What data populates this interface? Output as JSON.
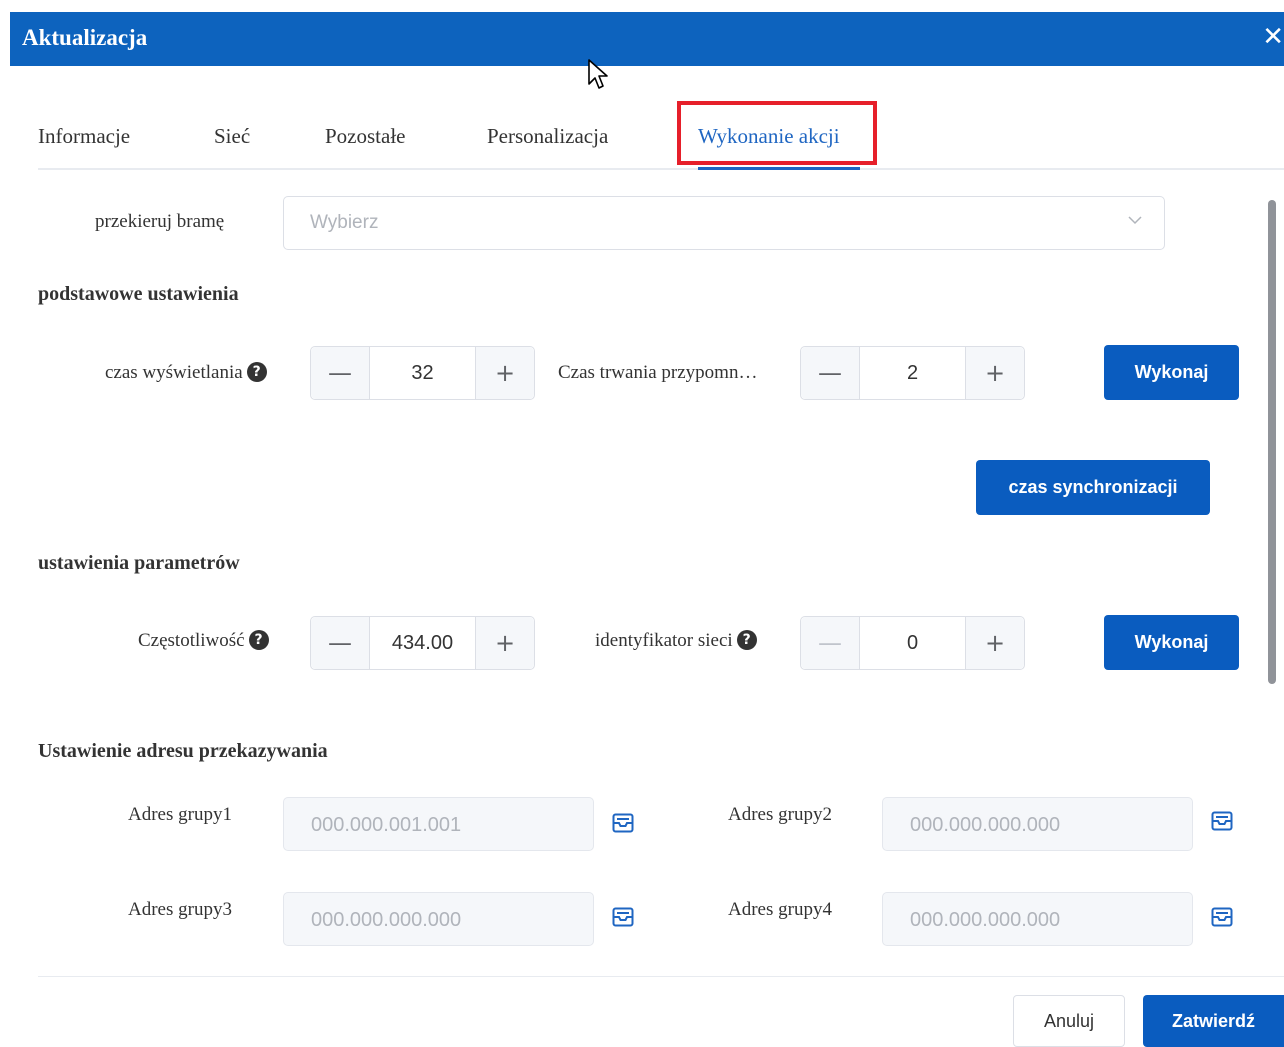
{
  "dialog": {
    "title": "Aktualizacja",
    "close_symbol": "✕"
  },
  "tabs": [
    {
      "label": "Informacje",
      "active": false
    },
    {
      "label": "Sieć",
      "active": false
    },
    {
      "label": "Pozostałe",
      "active": false
    },
    {
      "label": "Personalizacja",
      "active": false
    },
    {
      "label": "Wykonanie akcji",
      "active": true
    }
  ],
  "gateway": {
    "label": "przekieruj bramę",
    "placeholder": "Wybierz"
  },
  "basic": {
    "heading": "podstawowe ustawienia",
    "display_time": {
      "label": "czas wyświetlania",
      "value": "32"
    },
    "reminder": {
      "label": "Czas trwania przypomn…",
      "value": "2"
    },
    "execute_label": "Wykonaj",
    "sync_label": "czas synchronizacji"
  },
  "params": {
    "heading": "ustawienia parametrów",
    "frequency": {
      "label": "Częstotliwość",
      "value": "434.00"
    },
    "network_id": {
      "label": "identyfikator sieci",
      "value": "0"
    },
    "execute_label": "Wykonaj"
  },
  "forwarding": {
    "heading": "Ustawienie adresu przekazywania",
    "groups": [
      {
        "label": "Adres grupy1",
        "value": "000.000.001.001"
      },
      {
        "label": "Adres grupy2",
        "value": "000.000.000.000"
      },
      {
        "label": "Adres grupy3",
        "value": "000.000.000.000"
      },
      {
        "label": "Adres grupy4",
        "value": "000.000.000.000"
      }
    ]
  },
  "footer": {
    "cancel_label": "Anuluj",
    "submit_label": "Zatwierdź"
  },
  "symbols": {
    "minus": "—",
    "plus": "+",
    "help": "?"
  },
  "colors": {
    "primary": "#0a5cbf",
    "header": "#0d63be",
    "highlight": "#e61f2a",
    "active_tab": "#1f66c2"
  },
  "icons": {
    "close": "close-icon",
    "dropdown": "chevron-down-icon",
    "help": "help-icon",
    "address_action": "inbox-icon"
  }
}
